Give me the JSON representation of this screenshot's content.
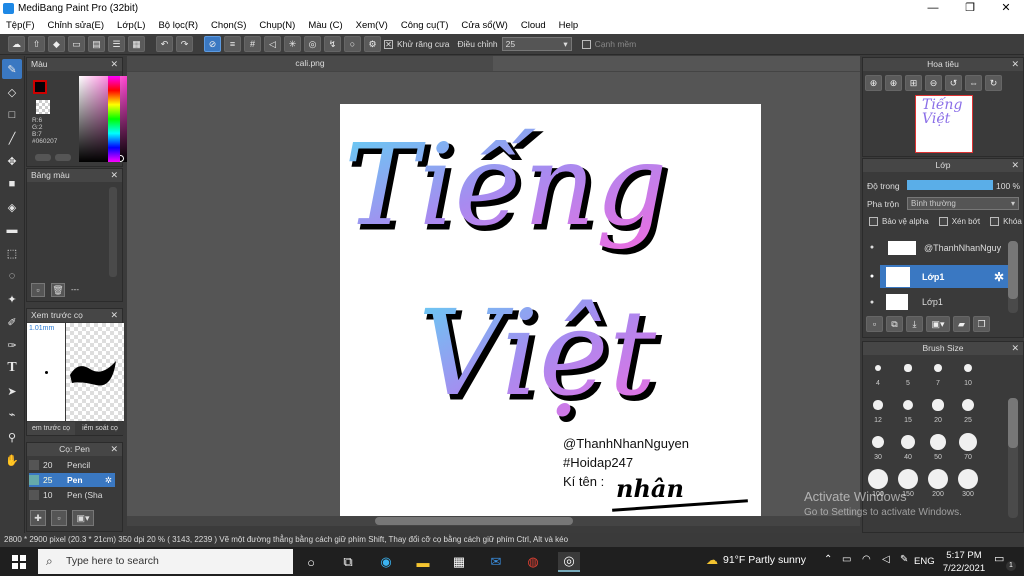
{
  "window": {
    "title": "MediBang Paint Pro (32bit)",
    "minimize": "—",
    "maximize": "❐",
    "close": "✕"
  },
  "menu": [
    "Tệp(F)",
    "Chỉnh sửa(E)",
    "Lớp(L)",
    "Bộ lọc(R)",
    "Chọn(S)",
    "Chụp(N)",
    "Màu (C)",
    "Xem(V)",
    "Công cụ(T)",
    "Cửa sổ(W)",
    "Cloud",
    "Help"
  ],
  "toolbar": {
    "antialias_label": "Khử răng cưa",
    "correction_label": "Điều chỉnh",
    "correction_value": "25",
    "edge_label": "Cạnh mềm"
  },
  "color_panel": {
    "title": "Màu",
    "r": "R:6",
    "g": "G:2",
    "b": "B:7",
    "hex": "#060207"
  },
  "palette_panel": {
    "title": "Bảng màu",
    "footer": "---"
  },
  "preview_panel": {
    "title": "Xem trước cọ",
    "size": "1.01mm",
    "tab1": "em trước cọ",
    "tab2": "iểm soát cọ"
  },
  "brush_panel": {
    "title": "Cọ: Pen",
    "items": [
      {
        "size": "20",
        "name": "Pencil"
      },
      {
        "size": "25",
        "name": "Pen"
      },
      {
        "size": "10",
        "name": "Pen (Sha"
      }
    ]
  },
  "document": {
    "tab": "cali.png"
  },
  "canvas_text": {
    "line1": "@ThanhNhanNguyen",
    "line2": "#Hoidap247",
    "line3": "Kí tên :",
    "big1": "Tiếng",
    "big2": "Việt",
    "signature": "nhân"
  },
  "navigator_panel": {
    "title": "Hoa tiêu"
  },
  "layer_panel": {
    "title": "Lớp",
    "opacity_label": "Độ trong",
    "opacity_value": "100 %",
    "opacity_fraction": 1.0,
    "blend_label": "Pha trộn",
    "blend_value": "Bình thường",
    "protect_alpha": "Bảo vệ alpha",
    "clipping": "Xén bớt",
    "lock": "Khóa",
    "layers": [
      {
        "name": "@ThanhNhanNguy",
        "selected": false
      },
      {
        "name": "Lớp1",
        "selected": true
      },
      {
        "name": "Lớp1",
        "selected": false
      }
    ]
  },
  "brushsize_panel": {
    "title": "Brush Size",
    "sizes": [
      "4",
      "5",
      "7",
      "10",
      "12",
      "15",
      "20",
      "25",
      "30",
      "40",
      "50",
      "70",
      "100",
      "150",
      "200",
      "300"
    ]
  },
  "status": {
    "text": "2800 * 2900 pixel   (20.3 * 21cm)   350 dpi   20 %   ( 3143, 2239 )   Vẽ một đường thẳng bằng cách giữ phím Shift, Thay đổi cỡ cọ bằng cách giữ phím Ctrl, Alt và kéo"
  },
  "watermark": {
    "line1": "Activate Windows",
    "line2": "Go to Settings to activate Windows."
  },
  "taskbar": {
    "search_placeholder": "Type here to search",
    "weather": "91°F  Partly sunny",
    "lang": "ENG",
    "time": "5:17 PM",
    "date": "7/22/2021",
    "notif": "1"
  }
}
